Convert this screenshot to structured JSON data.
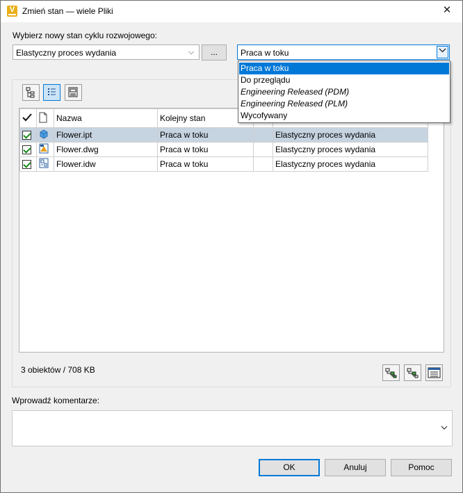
{
  "window": {
    "title": "Zmień stan — wiele Pliki",
    "close_glyph": "✕"
  },
  "lifecycle": {
    "prompt": "Wybierz nowy stan cyklu rozwojowego:",
    "definition_value": "Elastyczny proces wydania",
    "browse_label": "...",
    "state_value": "Praca w toku"
  },
  "state_dropdown": {
    "options": [
      {
        "label": "Praca w toku",
        "selected": true
      },
      {
        "label": "Do przeglądu"
      },
      {
        "label": "Engineering Released (PDM)"
      },
      {
        "label": "Engineering Released (PLM)"
      },
      {
        "label": "Wycofywany"
      }
    ]
  },
  "toolbar": {
    "icons": [
      "tree-view-icon",
      "list-view-icon",
      "tile-view-icon"
    ]
  },
  "grid": {
    "columns": [
      "",
      "",
      "Nazwa",
      "Kolejny stan",
      "",
      ""
    ],
    "rows": [
      {
        "checked": true,
        "icon": "part-file-icon",
        "name": "Flower.ipt",
        "next_state": "Praca w toku",
        "extra": "",
        "process": "Elastyczny proces wydania",
        "selected": true
      },
      {
        "checked": true,
        "icon": "drawing-dwg-icon",
        "name": "Flower.dwg",
        "next_state": "Praca w toku",
        "extra": "",
        "process": "Elastyczny proces wydania"
      },
      {
        "checked": true,
        "icon": "drawing-idw-icon",
        "name": "Flower.idw",
        "next_state": "Praca w toku",
        "extra": "",
        "process": "Elastyczny proces wydania"
      }
    ]
  },
  "status": {
    "count_text": "3 obiektów / 708 KB"
  },
  "comment": {
    "label": "Wprowadź komentarze:",
    "value": ""
  },
  "buttons": {
    "ok": "OK",
    "cancel": "Anuluj",
    "help": "Pomoc"
  },
  "colors": {
    "accent": "#0078d7",
    "selected_row": "#c6d3e0",
    "app_icon": "#e9b01a"
  }
}
